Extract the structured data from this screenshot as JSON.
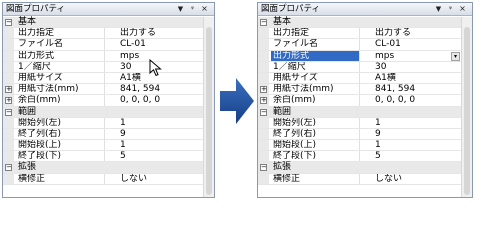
{
  "panel_title": "図面プロパティ",
  "titlebar_buttons": [
    "▼",
    "ᵠ",
    "×"
  ],
  "toggle_minus": "−",
  "toggle_plus": "+",
  "categories": {
    "basic": "基本",
    "range": "範囲",
    "extend": "拡張"
  },
  "left": {
    "basic_rows": [
      {
        "name": "出力指定",
        "value": "出力する"
      },
      {
        "name": "ファイル名",
        "value": "CL-01"
      },
      {
        "name": "出力形式",
        "value": "mps"
      },
      {
        "name": "1／縮尺",
        "value": "30"
      },
      {
        "name": "用紙サイズ",
        "value": "A1横"
      },
      {
        "name": "用紙寸法(mm)",
        "value": "841, 594"
      },
      {
        "name": "余白(mm)",
        "value": "0, 0, 0, 0"
      }
    ],
    "range_rows": [
      {
        "name": "開始列(左)",
        "value": "1"
      },
      {
        "name": "終了列(右)",
        "value": "9"
      },
      {
        "name": "開始段(上)",
        "value": "1"
      },
      {
        "name": "終了段(下)",
        "value": "5"
      }
    ],
    "extend_rows": [
      {
        "name": "横修正",
        "value": "しない"
      }
    ]
  },
  "right": {
    "basic_rows": [
      {
        "name": "出力指定",
        "value": "出力する"
      },
      {
        "name": "ファイル名",
        "value": "CL-01"
      },
      {
        "name": "出力形式",
        "value": "mps"
      },
      {
        "name": "1／縮尺",
        "value": "30"
      },
      {
        "name": "用紙サイズ",
        "value": "A1横"
      },
      {
        "name": "用紙寸法(mm)",
        "value": "841, 594"
      },
      {
        "name": "余白(mm)",
        "value": "0, 0, 0, 0"
      }
    ],
    "range_rows": [
      {
        "name": "開始列(左)",
        "value": "1"
      },
      {
        "name": "終了列(右)",
        "value": "9"
      },
      {
        "name": "開始段(上)",
        "value": "1"
      },
      {
        "name": "終了段(下)",
        "value": "5"
      }
    ],
    "extend_rows": [
      {
        "name": "横修正",
        "value": "しない"
      }
    ],
    "dropdown_glyph": "▾"
  },
  "colors": {
    "selection": "#316ac5",
    "arrow": "#1f4f9a",
    "category_bg": "#e9e9e9"
  }
}
